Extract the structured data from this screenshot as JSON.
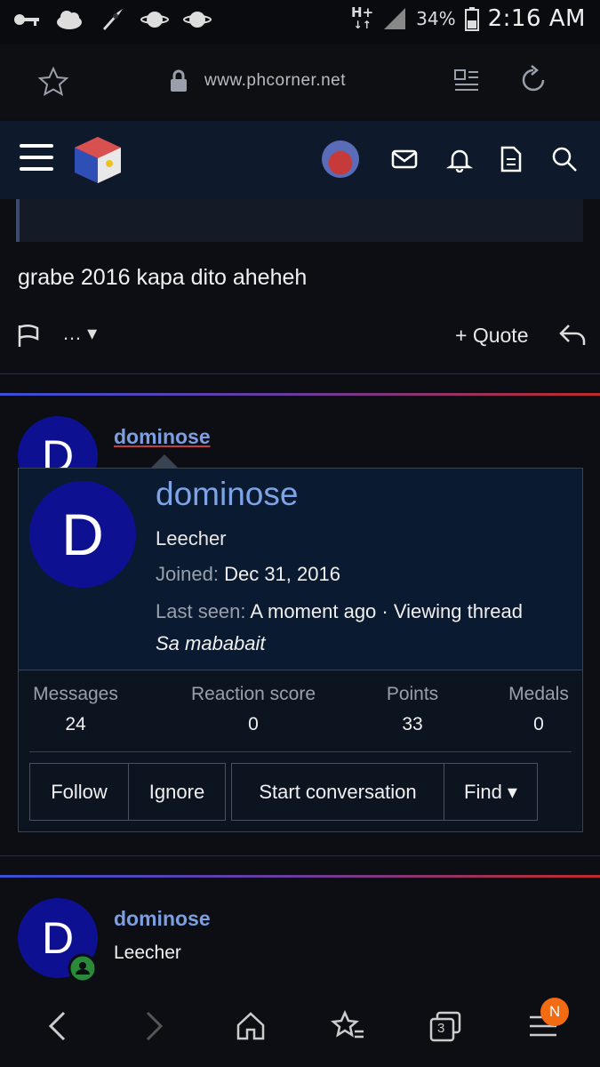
{
  "status_bar": {
    "network": "H+",
    "battery": "34%",
    "time": "2:16 AM",
    "icons": [
      "key-icon",
      "cloud-icon",
      "rocket-icon",
      "planet-icon",
      "planet-icon"
    ]
  },
  "browser": {
    "url": "www.phcorner.net"
  },
  "post": {
    "text": "grabe 2016 kapa dito aheheh",
    "quote_label": "Quote",
    "more_label": "…"
  },
  "second_post": {
    "username": "dominose",
    "avatar_letter": "D"
  },
  "profile_card": {
    "avatar_letter": "D",
    "username": "dominose",
    "title": "Leecher",
    "joined_label": "Joined:",
    "joined_value": "Dec 31, 2016",
    "last_seen_label": "Last seen:",
    "last_seen_value": "A moment ago · Viewing thread",
    "signature": "Sa mababait",
    "stats": [
      {
        "label": "Messages",
        "value": "24"
      },
      {
        "label": "Reaction score",
        "value": "0"
      },
      {
        "label": "Points",
        "value": "33"
      },
      {
        "label": "Medals",
        "value": "0"
      }
    ],
    "buttons": {
      "follow": "Follow",
      "ignore": "Ignore",
      "start_conversation": "Start conversation",
      "find": "Find"
    }
  },
  "third_post": {
    "username": "dominose",
    "title": "Leecher",
    "avatar_letter": "D"
  },
  "bottom_nav": {
    "tabs_count": "3",
    "badge": "N"
  },
  "colors": {
    "accent_link": "#7ea3e6",
    "avatar_bg": "#0d1191",
    "badge": "#f26a12"
  }
}
